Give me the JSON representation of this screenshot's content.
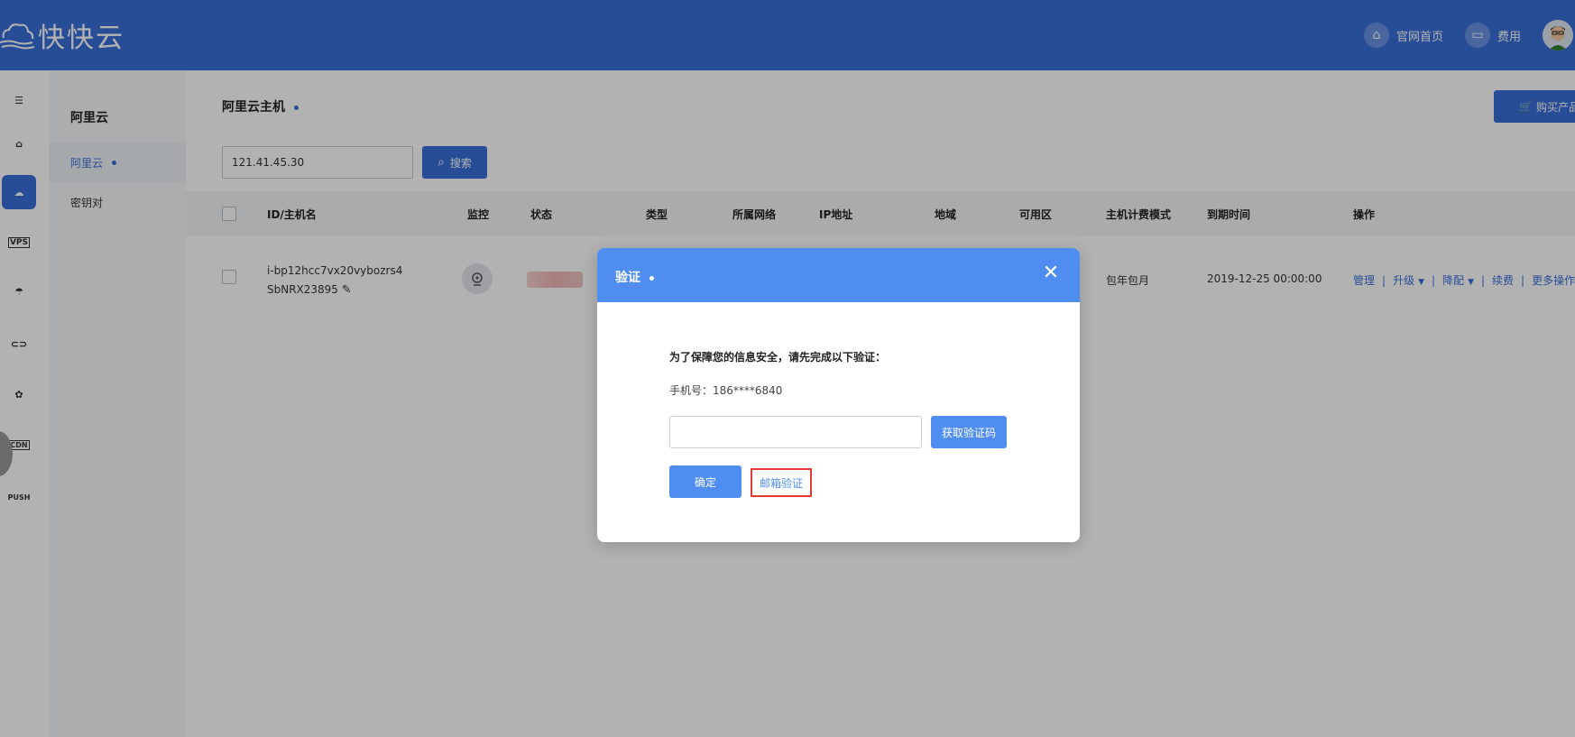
{
  "header": {
    "logo_text": "快快云",
    "home_label": "官网首页",
    "fee_label": "费用"
  },
  "subnav": {
    "title": "阿里云",
    "items": [
      {
        "label": "阿里云"
      },
      {
        "label": "密钥对"
      }
    ]
  },
  "rail": {
    "items": [
      "menu",
      "home",
      "cloud",
      "VPS",
      "umbrella",
      "link",
      "huawei",
      "CDN",
      "PUSH"
    ],
    "vps_label": "VPS",
    "cdn_label": "CDN",
    "push_label": "PUSH"
  },
  "main": {
    "title": "阿里云主机",
    "buy_label": "购买产品",
    "search": {
      "value": "121.41.45.30",
      "button_label": "搜索"
    },
    "table": {
      "headers": [
        "ID/主机名",
        "监控",
        "状态",
        "类型",
        "所属网络",
        "IP地址",
        "地域",
        "可用区",
        "主机计费模式",
        "到期时间",
        "操作"
      ],
      "rows": [
        {
          "id_line1": "i-bp12hcc7vx20vybozrs4",
          "id_line2": "SbNRX23895",
          "billing": "包年包月",
          "expire": "2019-12-25 00:00:00",
          "ops": [
            "管理",
            "升级",
            "降配",
            "续费",
            "更多操作"
          ]
        }
      ]
    }
  },
  "modal": {
    "title": "验证",
    "description": "为了保障您的信息安全，请先完成以下验证：",
    "phone": "手机号：186****6840",
    "code_value": "",
    "get_code_label": "获取验证码",
    "confirm_label": "确定",
    "email_verify_label": "邮箱验证"
  },
  "colors": {
    "brand": "#3a6fd8",
    "modal_header": "#4f8ef0",
    "highlight_border": "#e53935"
  }
}
